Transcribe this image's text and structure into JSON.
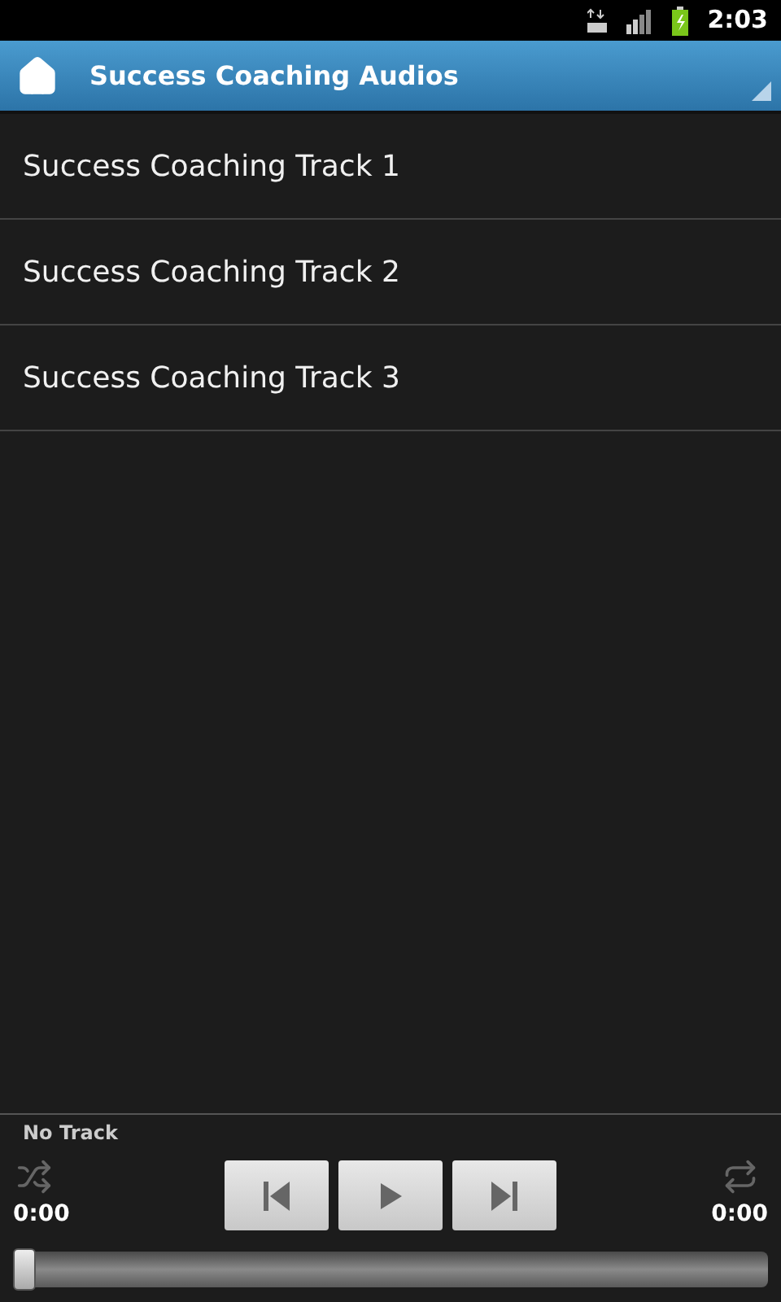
{
  "status_bar": {
    "time": "2:03"
  },
  "app_bar": {
    "title": "Success Coaching Audios"
  },
  "tracks": [
    {
      "title": "Success Coaching Track 1"
    },
    {
      "title": "Success Coaching Track 2"
    },
    {
      "title": "Success Coaching Track 3"
    }
  ],
  "player": {
    "now_playing": "No Track",
    "elapsed": "0:00",
    "duration": "0:00",
    "seek": {
      "level": 0
    }
  }
}
